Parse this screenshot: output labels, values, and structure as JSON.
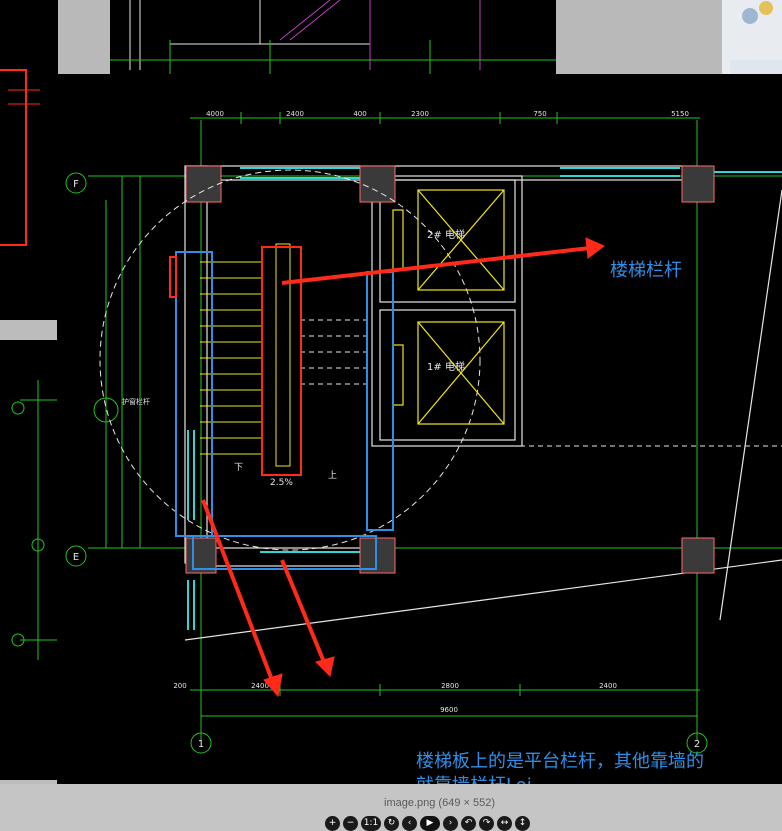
{
  "viewer": {
    "caption": "image.png (649 × 552)",
    "toolbar": [
      {
        "name": "zoom-in-button",
        "glyph": "+"
      },
      {
        "name": "zoom-out-button",
        "glyph": "−"
      },
      {
        "name": "actual-size-button",
        "glyph": "1:1"
      },
      {
        "name": "reset-button",
        "glyph": "↻"
      },
      {
        "name": "prev-button",
        "glyph": "‹"
      },
      {
        "name": "play-button",
        "glyph": "▶"
      },
      {
        "name": "next-button",
        "glyph": "›"
      },
      {
        "name": "rotate-left-button",
        "glyph": "↶"
      },
      {
        "name": "rotate-right-button",
        "glyph": "↷"
      },
      {
        "name": "flip-horizontal-button",
        "glyph": "↔"
      },
      {
        "name": "flip-vertical-button",
        "glyph": "↕"
      }
    ]
  },
  "annotations": {
    "railing_label": "楼梯栏杆",
    "note_line1": "楼梯板上的是平台栏杆，其他靠墙的",
    "note_line2": "就靠墙栏杆Loi"
  },
  "drawing": {
    "grid_rows": [
      "F",
      "E"
    ],
    "grid_cols": [
      "1",
      "2"
    ],
    "top_dims": [
      "4000",
      "2400",
      "400",
      "2300",
      "750",
      "5150"
    ],
    "bottom_dims": [
      "200",
      "2400",
      "2800",
      "2400"
    ],
    "total_dim": "9600",
    "elevator_labels": [
      "2# 电梯",
      "1# 电梯"
    ],
    "mark_labels": [
      "2.5%",
      "上",
      "下",
      "护窗栏杆"
    ],
    "colors": {
      "cad_bg": "#000000",
      "grid_green": "#22c322",
      "wall_white": "#e6e6e6",
      "yellow": "#f2e61a",
      "cyan": "#30d6d6",
      "red_mark": "#ff2a1a",
      "blue_mark": "#2f8fe8"
    }
  }
}
